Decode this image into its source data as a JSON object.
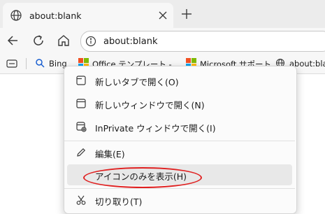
{
  "tab": {
    "title": "about:blank",
    "close_icon": "close-icon",
    "favicon": "globe-icon"
  },
  "new_tab_icon": "plus-icon",
  "toolbar": {
    "back_icon": "back-arrow-icon",
    "refresh_icon": "refresh-icon",
    "home_icon": "home-icon",
    "address": {
      "value": "about:blank",
      "info_icon": "info-icon"
    }
  },
  "favorites_bar": {
    "items": [
      {
        "label": "Bing",
        "icon": "search-icon"
      },
      {
        "label": "Office テンプレート -",
        "icon": "microsoft-logo-icon"
      },
      {
        "label": "Microsoft サポート",
        "icon": "microsoft-logo-icon"
      },
      {
        "label": "about:bla",
        "icon": "globe-icon"
      }
    ]
  },
  "context_menu": {
    "items": [
      {
        "label": "新しいタブで開く(O)",
        "icon": "new-tab-icon"
      },
      {
        "label": "新しいウィンドウで開く(N)",
        "icon": "new-window-icon"
      },
      {
        "label": "InPrivate ウィンドウで開く(I)",
        "icon": "inprivate-window-icon"
      },
      {
        "label": "編集(E)",
        "icon": "pencil-icon"
      },
      {
        "label": "アイコンのみを表示(H)",
        "icon": "",
        "highlighted": true
      },
      {
        "label": "切り取り(T)",
        "icon": "scissors-icon"
      }
    ]
  },
  "colors": {
    "highlight_ellipse": "#e02020",
    "hover_background": "#e8e8e8",
    "ms_logo": [
      "#f25022",
      "#7fba00",
      "#00a4ef",
      "#ffb900"
    ]
  }
}
